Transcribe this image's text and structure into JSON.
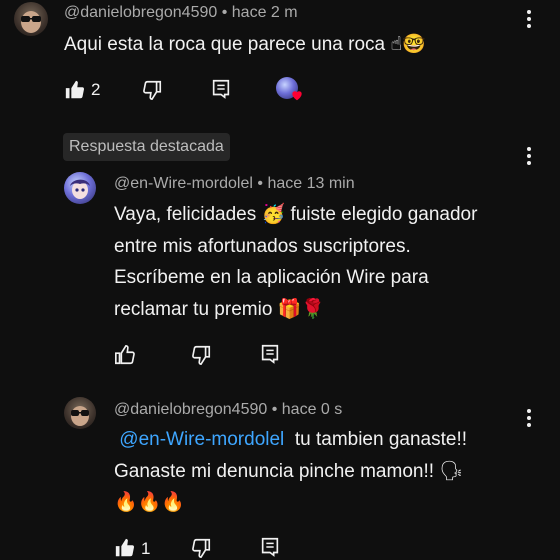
{
  "comment1": {
    "author": "@danielobregon4590",
    "time": "hace 2 m",
    "text": "Aqui esta la roca que parece una roca",
    "emojis": "☝🤓",
    "likes": "2"
  },
  "highlight_label": "Respuesta destacada",
  "reply1": {
    "author": "@en-Wire-mordolel",
    "time": "hace 13 min",
    "line1": "Vaya, felicidades",
    "emoji1": "🥳",
    "line1b": "fuiste elegido ganador",
    "line2": "entre mis afortunados suscriptores.",
    "line3": "Escríbeme en la aplicación Wire para",
    "line4": "reclamar tu premio",
    "emoji4": "🎁🌹"
  },
  "reply2": {
    "author": "@danielobregon4590",
    "time": "hace 0 s",
    "mention": "@en-Wire-mordolel",
    "line1": "tu tambien ganaste!!",
    "line2": "Ganaste mi denuncia pinche mamon!!",
    "emoji2": "🗣",
    "fires": "🔥🔥🔥",
    "likes": "1"
  },
  "icons": [
    "thumbs-up-icon",
    "thumbs-down-icon",
    "reply-icon",
    "more-vert-icon",
    "heart-icon"
  ],
  "colors": {
    "background": "#0f0f0f",
    "text": "#f1f1f1",
    "meta": "#aaaaaa",
    "mention": "#3ea6ff",
    "heart": "#ff0033"
  }
}
